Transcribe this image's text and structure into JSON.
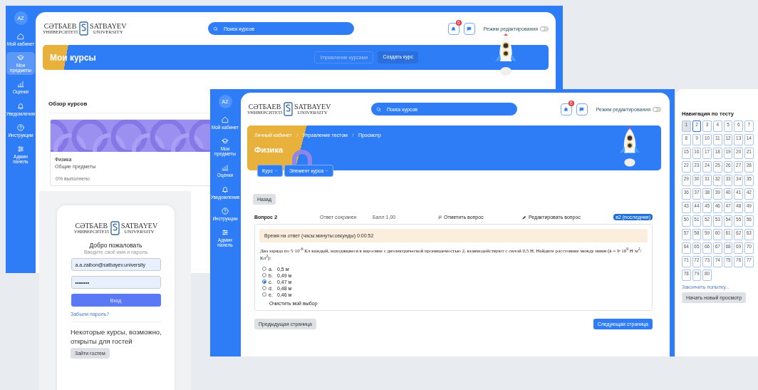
{
  "back_window": {
    "avatar": "AZ",
    "sidebar": [
      {
        "label": "Мой кабинет",
        "selected": false
      },
      {
        "label": "Мои предметы",
        "selected": true
      },
      {
        "label": "Оценки",
        "selected": false
      },
      {
        "label": "Уведомления",
        "selected": false
      },
      {
        "label": "Инструкции",
        "selected": false
      },
      {
        "label": "Админ панель",
        "selected": false
      }
    ],
    "logo": {
      "left_top": "СӘТБАЕВ",
      "left_bottom": "УНИВЕРСИТЕТІ",
      "right_top": "SATBAYEV",
      "right_bottom": "UNIVERSITY"
    },
    "search": {
      "placeholder": "Поиск курсов"
    },
    "notification_badge": "6",
    "edit_mode": {
      "label": "Режим редактирования",
      "on": false
    },
    "banner": {
      "title": "Мои курсы",
      "buttons": [
        "Управление курсами",
        "Создать курс"
      ]
    },
    "section_title": "Обзор курсов",
    "course_card": {
      "name": "Физика",
      "category": "Общие предметы",
      "progress": "0% выполнено"
    }
  },
  "login": {
    "logo": {
      "left_top": "СӘТБАЕВ",
      "left_bottom": "УНИВЕРСИТЕТІ",
      "right_top": "SATBAYEV",
      "right_bottom": "UNIVERSITY"
    },
    "title": "Добро пожаловать",
    "subtitle": "Введите своё имя и пароль",
    "email": "a.a.zaibon@satbayev.university",
    "password": "••••••••",
    "submit": "Вход",
    "forgot": "Забыли пароль?",
    "guest_text": "Некоторые курсы, возможно, открыты для гостей",
    "guest_button": "Зайти гостем"
  },
  "front_window": {
    "avatar": "AZ",
    "sidebar": [
      {
        "label": "Мой кабинет",
        "selected": false
      },
      {
        "label": "Мои предметы",
        "selected": false
      },
      {
        "label": "Оценки",
        "selected": false
      },
      {
        "label": "Уведомления",
        "selected": false
      },
      {
        "label": "Инструкции",
        "selected": false
      },
      {
        "label": "Админ панель",
        "selected": false
      }
    ],
    "logo": {
      "left_top": "СӘТБАЕВ",
      "left_bottom": "УНИВЕРСИТЕТІ",
      "right_top": "SATBAYEV",
      "right_bottom": "UNIVERSITY"
    },
    "search": {
      "placeholder": "Поиск курсов"
    },
    "notification_badge": "6",
    "edit_mode": {
      "label": "Режим редактирования",
      "on": false
    },
    "breadcrumbs": [
      "Личный кабинет",
      "Управление тестом",
      "Просмотр"
    ],
    "title": "Физика",
    "dropdowns": [
      "Курс",
      "Элемент курса"
    ],
    "back_button": "Назад",
    "question": {
      "label": "Вопрос",
      "number": "2",
      "status": "Ответ сохранен",
      "grade": "Балл 1,00",
      "flag": "Отметить вопрос",
      "edit": "Редактировать вопрос",
      "version": "в2 (последняя)",
      "timer": "Время на ответ (часы:минуты:секунды) 0:00:52",
      "text": "Два заряда по 5·10$^{-6}$ Кл каждый, находящиеся в керосине с диэлектрической проницаемостью 2, взаимодействуют с силой 0,5 Н. Найдите расстояние между ними (k = 9·10$^{9}$ Н·м$^{2}$/Кл$^{2}$):",
      "options": [
        {
          "letter": "a.",
          "text": "0,5 м",
          "selected": false
        },
        {
          "letter": "b.",
          "text": "0,49 м",
          "selected": false
        },
        {
          "letter": "c.",
          "text": "0,47 м",
          "selected": true
        },
        {
          "letter": "d.",
          "text": "0,48 м",
          "selected": false
        },
        {
          "letter": "e.",
          "text": "0,46 м",
          "selected": false
        }
      ],
      "clear": "Очистить мой выбор"
    },
    "prev_button": "Предыдущая страница",
    "next_button": "Следующая страница"
  },
  "quiz_nav": {
    "title": "Навигация по тесту",
    "questions": [
      {
        "label": "1",
        "answered": true,
        "selected": false
      },
      {
        "label": "2",
        "answered": false,
        "selected": true
      },
      {
        "label": "3",
        "answered": false,
        "selected": false
      },
      {
        "label": "4",
        "answered": false,
        "selected": false
      },
      {
        "label": "5",
        "answered": false,
        "selected": false
      },
      {
        "label": "6",
        "answered": false,
        "selected": false
      },
      {
        "label": "7",
        "answered": false,
        "selected": false
      },
      {
        "label": "8",
        "answered": false,
        "selected": false
      },
      {
        "label": "9",
        "answered": false,
        "selected": false
      },
      {
        "label": "10",
        "answered": false,
        "selected": false
      },
      {
        "label": "11",
        "answered": false,
        "selected": false
      },
      {
        "label": "12",
        "answered": false,
        "selected": false
      },
      {
        "label": "13",
        "answered": false,
        "selected": false
      },
      {
        "label": "14",
        "answered": false,
        "selected": false
      },
      {
        "label": "15",
        "answered": false,
        "selected": false
      },
      {
        "label": "16",
        "answered": false,
        "selected": false
      },
      {
        "label": "17",
        "answered": false,
        "selected": false
      },
      {
        "label": "18",
        "answered": false,
        "selected": false
      },
      {
        "label": "19",
        "answered": false,
        "selected": false
      },
      {
        "label": "20",
        "answered": false,
        "selected": false
      },
      {
        "label": "21",
        "answered": false,
        "selected": false
      },
      {
        "label": "22",
        "answered": false,
        "selected": false
      },
      {
        "label": "23",
        "answered": false,
        "selected": false
      },
      {
        "label": "24",
        "answered": false,
        "selected": false
      },
      {
        "label": "25",
        "answered": false,
        "selected": false
      },
      {
        "label": "26",
        "answered": false,
        "selected": false
      },
      {
        "label": "27",
        "answered": false,
        "selected": false
      },
      {
        "label": "28",
        "answered": false,
        "selected": false
      },
      {
        "label": "29",
        "answered": false,
        "selected": false
      },
      {
        "label": "30",
        "answered": false,
        "selected": false
      },
      {
        "label": "31",
        "answered": false,
        "selected": false
      },
      {
        "label": "32",
        "answered": false,
        "selected": false
      },
      {
        "label": "33",
        "answered": false,
        "selected": false
      },
      {
        "label": "34",
        "answered": false,
        "selected": false
      },
      {
        "label": "35",
        "answered": false,
        "selected": false
      },
      {
        "label": "36",
        "answered": false,
        "selected": false
      },
      {
        "label": "37",
        "answered": false,
        "selected": false
      },
      {
        "label": "38",
        "answered": false,
        "selected": false
      },
      {
        "label": "39",
        "answered": false,
        "selected": false
      },
      {
        "label": "40",
        "answered": false,
        "selected": false
      },
      {
        "label": "41",
        "answered": false,
        "selected": false
      },
      {
        "label": "42",
        "answered": false,
        "selected": false
      },
      {
        "label": "43",
        "answered": false,
        "selected": false
      },
      {
        "label": "44",
        "answered": false,
        "selected": false
      },
      {
        "label": "45",
        "answered": false,
        "selected": false
      },
      {
        "label": "46",
        "answered": false,
        "selected": false
      },
      {
        "label": "47",
        "answered": false,
        "selected": false
      },
      {
        "label": "48",
        "answered": false,
        "selected": false
      },
      {
        "label": "49",
        "answered": false,
        "selected": false
      },
      {
        "label": "50",
        "answered": false,
        "selected": false
      },
      {
        "label": "51",
        "answered": false,
        "selected": false
      },
      {
        "label": "52",
        "answered": false,
        "selected": false
      },
      {
        "label": "53",
        "answered": false,
        "selected": false
      },
      {
        "label": "54",
        "answered": false,
        "selected": false
      },
      {
        "label": "55",
        "answered": false,
        "selected": false
      },
      {
        "label": "56",
        "answered": false,
        "selected": false
      },
      {
        "label": "57",
        "answered": false,
        "selected": false
      },
      {
        "label": "58",
        "answered": false,
        "selected": false
      },
      {
        "label": "59",
        "answered": false,
        "selected": false
      },
      {
        "label": "60",
        "answered": false,
        "selected": false
      },
      {
        "label": "61",
        "answered": false,
        "selected": false
      },
      {
        "label": "62",
        "answered": false,
        "selected": false
      },
      {
        "label": "63",
        "answered": false,
        "selected": false
      },
      {
        "label": "64",
        "answered": false,
        "selected": false
      },
      {
        "label": "65",
        "answered": false,
        "selected": false
      },
      {
        "label": "66",
        "answered": false,
        "selected": false
      },
      {
        "label": "67",
        "answered": false,
        "selected": false
      },
      {
        "label": "68",
        "answered": false,
        "selected": false
      },
      {
        "label": "69",
        "answered": false,
        "selected": false
      },
      {
        "label": "70",
        "answered": false,
        "selected": false
      },
      {
        "label": "71",
        "answered": false,
        "selected": false
      },
      {
        "label": "72",
        "answered": false,
        "selected": false
      },
      {
        "label": "73",
        "answered": false,
        "selected": false
      },
      {
        "label": "74",
        "answered": false,
        "selected": false
      },
      {
        "label": "75",
        "answered": false,
        "selected": false
      },
      {
        "label": "76",
        "answered": false,
        "selected": false
      },
      {
        "label": "77",
        "answered": false,
        "selected": false
      },
      {
        "label": "78",
        "answered": false,
        "selected": false
      },
      {
        "label": "79",
        "answered": false,
        "selected": false
      },
      {
        "label": "80",
        "answered": false,
        "selected": false
      }
    ],
    "finish": "Закончить попытку...",
    "restart": "Начать новый просмотр"
  }
}
